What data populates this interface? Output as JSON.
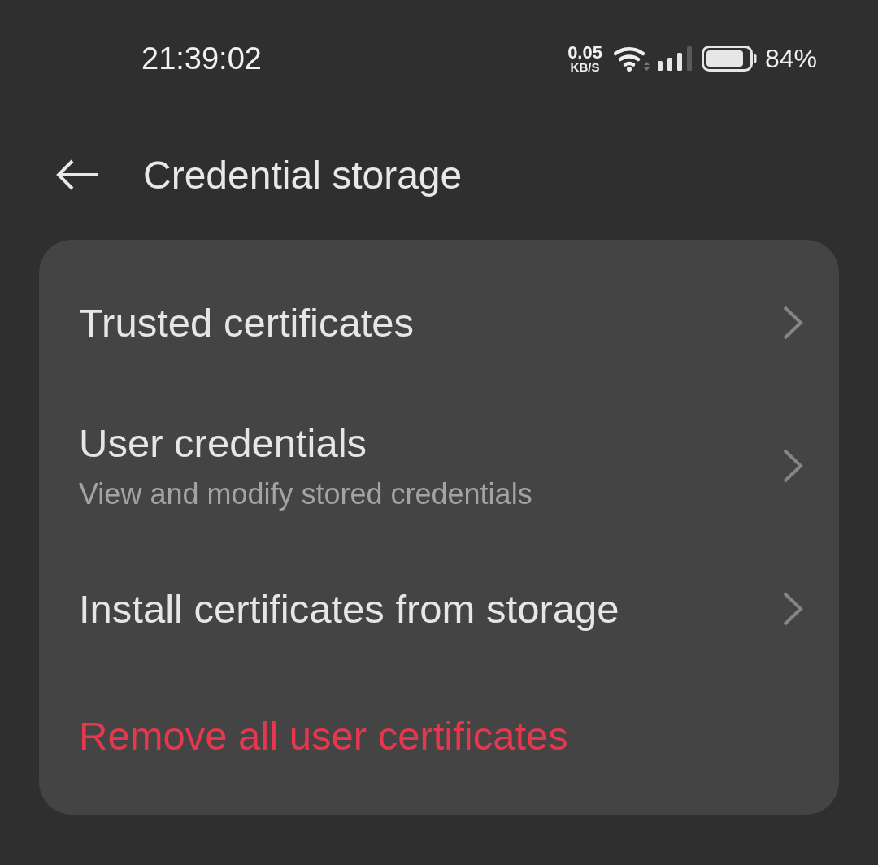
{
  "status_bar": {
    "time": "21:39:02",
    "net_speed": "0.05",
    "net_unit": "KB/S",
    "battery": "84%"
  },
  "header": {
    "title": "Credential storage"
  },
  "items": [
    {
      "kind": "link",
      "title": "Trusted certificates"
    },
    {
      "kind": "link",
      "title": "User credentials",
      "subtitle": "View and modify stored credentials"
    },
    {
      "kind": "link",
      "title": "Install certificates from storage"
    },
    {
      "kind": "danger",
      "title": "Remove all user certificates"
    }
  ]
}
